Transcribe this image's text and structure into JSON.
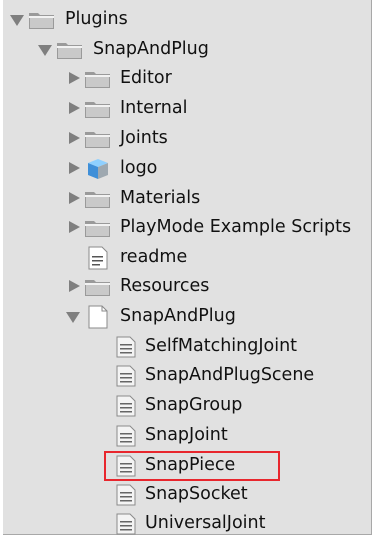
{
  "tree": {
    "items": [
      {
        "label": "Plugins",
        "icon": "folder-icon",
        "expand": "expanded"
      },
      {
        "label": "SnapAndPlug",
        "icon": "folder-icon",
        "expand": "expanded"
      },
      {
        "label": "Editor",
        "icon": "folder-icon",
        "expand": "collapsed"
      },
      {
        "label": "Internal",
        "icon": "folder-icon",
        "expand": "collapsed"
      },
      {
        "label": "Joints",
        "icon": "folder-icon",
        "expand": "collapsed"
      },
      {
        "label": "logo",
        "icon": "cube-icon",
        "expand": "collapsed"
      },
      {
        "label": "Materials",
        "icon": "folder-icon",
        "expand": "collapsed"
      },
      {
        "label": "PlayMode Example Scripts",
        "icon": "folder-icon",
        "expand": "collapsed"
      },
      {
        "label": "readme",
        "icon": "text-file-icon",
        "expand": "none"
      },
      {
        "label": "Resources",
        "icon": "folder-icon",
        "expand": "collapsed"
      },
      {
        "label": "SnapAndPlug",
        "icon": "blank-file-icon",
        "expand": "expanded"
      },
      {
        "label": "SelfMatchingJoint",
        "icon": "script-icon",
        "expand": "none"
      },
      {
        "label": "SnapAndPlugScene",
        "icon": "script-icon",
        "expand": "none"
      },
      {
        "label": "SnapGroup",
        "icon": "script-icon",
        "expand": "none"
      },
      {
        "label": "SnapJoint",
        "icon": "script-icon",
        "expand": "none"
      },
      {
        "label": "SnapPiece",
        "icon": "script-icon",
        "expand": "none"
      },
      {
        "label": "SnapSocket",
        "icon": "script-icon",
        "expand": "none"
      },
      {
        "label": "UniversalJoint",
        "icon": "script-icon",
        "expand": "none"
      }
    ],
    "highlighted_item": "SnapPiece"
  },
  "colors": {
    "panel_background": "#e1e1e1",
    "arrow": "#7f7f7f",
    "highlight_border": "#e8262d",
    "folder": "#9a9a9a",
    "cube": "#4aa0e6"
  }
}
